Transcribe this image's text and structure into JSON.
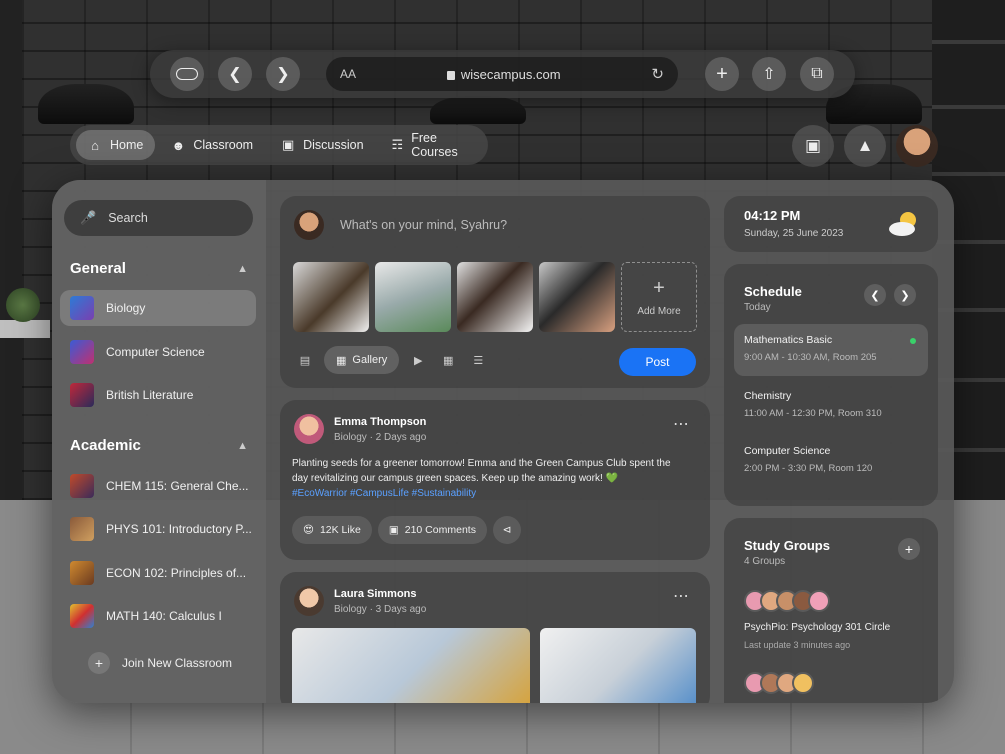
{
  "browser": {
    "url": "wisecampus.com",
    "text_size_label": "AA"
  },
  "nav": {
    "items": [
      {
        "label": "Home",
        "icon": "home-icon"
      },
      {
        "label": "Classroom",
        "icon": "people-icon"
      },
      {
        "label": "Discussion",
        "icon": "chat-icon"
      },
      {
        "label": "Free Courses",
        "icon": "book-icon"
      }
    ]
  },
  "sidebar": {
    "search_placeholder": "Search",
    "general_title": "General",
    "general": [
      "Biology",
      "Computer Science",
      "British Literature"
    ],
    "academic_title": "Academic",
    "academic": [
      "CHEM 115: General Che...",
      "PHYS 101: Introductory P...",
      "ECON 102: Principles of...",
      "MATH 140: Calculus I"
    ],
    "join_label": "Join New Classroom"
  },
  "composer": {
    "placeholder": "What's on your mind, Syahru?",
    "add_more": "Add More",
    "gallery_label": "Gallery",
    "post_label": "Post"
  },
  "posts": [
    {
      "author": "Emma Thompson",
      "meta": "Biology · 2 Days ago",
      "text": "Planting seeds for a greener tomorrow! Emma and the Green Campus Club spent the day revitalizing our campus green spaces. Keep up the amazing work! 💚",
      "tags": "#EcoWarrior #CampusLife #Sustainability",
      "likes": "12K Like",
      "comments": "210 Comments"
    },
    {
      "author": "Laura Simmons",
      "meta": "Biology · 3 Days ago"
    }
  ],
  "clock": {
    "time": "04:12 PM",
    "date": "Sunday, 25 June 2023"
  },
  "schedule": {
    "title": "Schedule",
    "subtitle": "Today",
    "items": [
      {
        "title": "Mathematics Basic",
        "time": "9:00 AM - 10:30 AM, Room 205"
      },
      {
        "title": "Chemistry",
        "time": "11:00 AM - 12:30 PM, Room 310"
      },
      {
        "title": "Computer Science",
        "time": "2:00 PM - 3:30 PM, Room 120"
      }
    ]
  },
  "study_groups": {
    "title": "Study Groups",
    "count": "4 Groups",
    "group_name": "PsychPio: Psychology 301 Circle",
    "group_update": "Last update 3 minutes ago"
  },
  "colors": {
    "accent": "#1a73f5",
    "hashtag": "#5aa0ff",
    "online": "#3ad16a"
  }
}
